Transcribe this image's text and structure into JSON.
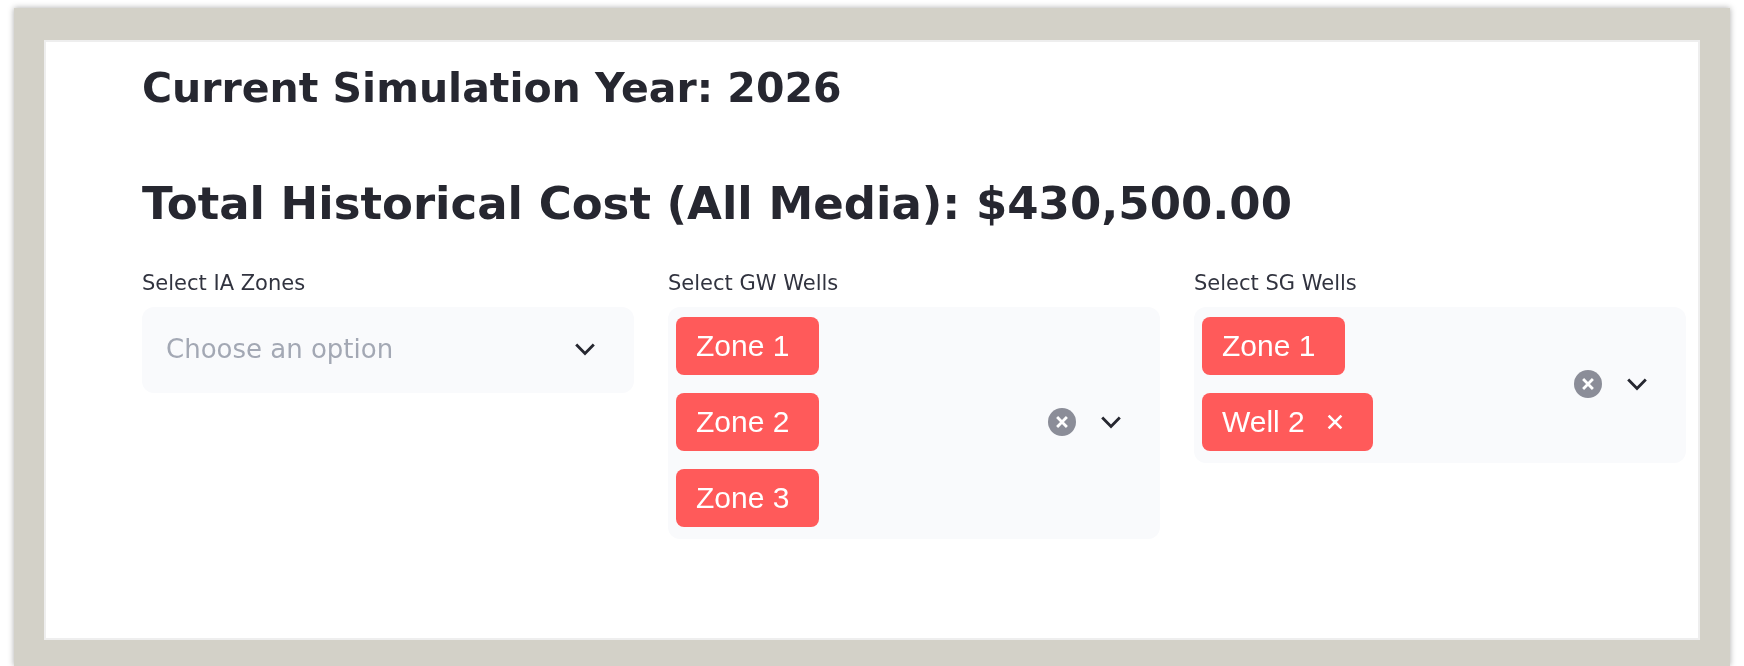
{
  "headings": [
    "Current Simulation Year: 2026",
    "Total Historical Cost (All Media): $430,500.00"
  ],
  "selects": [
    {
      "label": "Select IA Zones",
      "placeholder": "Choose an option"
    },
    {
      "label": "Select GW Wells",
      "tags": [
        {
          "text": "Zone 1",
          "removable": false
        },
        {
          "text": "Zone 2",
          "removable": false
        },
        {
          "text": "Zone 3",
          "removable": false
        }
      ]
    },
    {
      "label": "Select SG Wells",
      "tags": [
        {
          "text": "Zone 1",
          "removable": false
        },
        {
          "text": "Well 2",
          "removable": true
        }
      ]
    }
  ]
}
